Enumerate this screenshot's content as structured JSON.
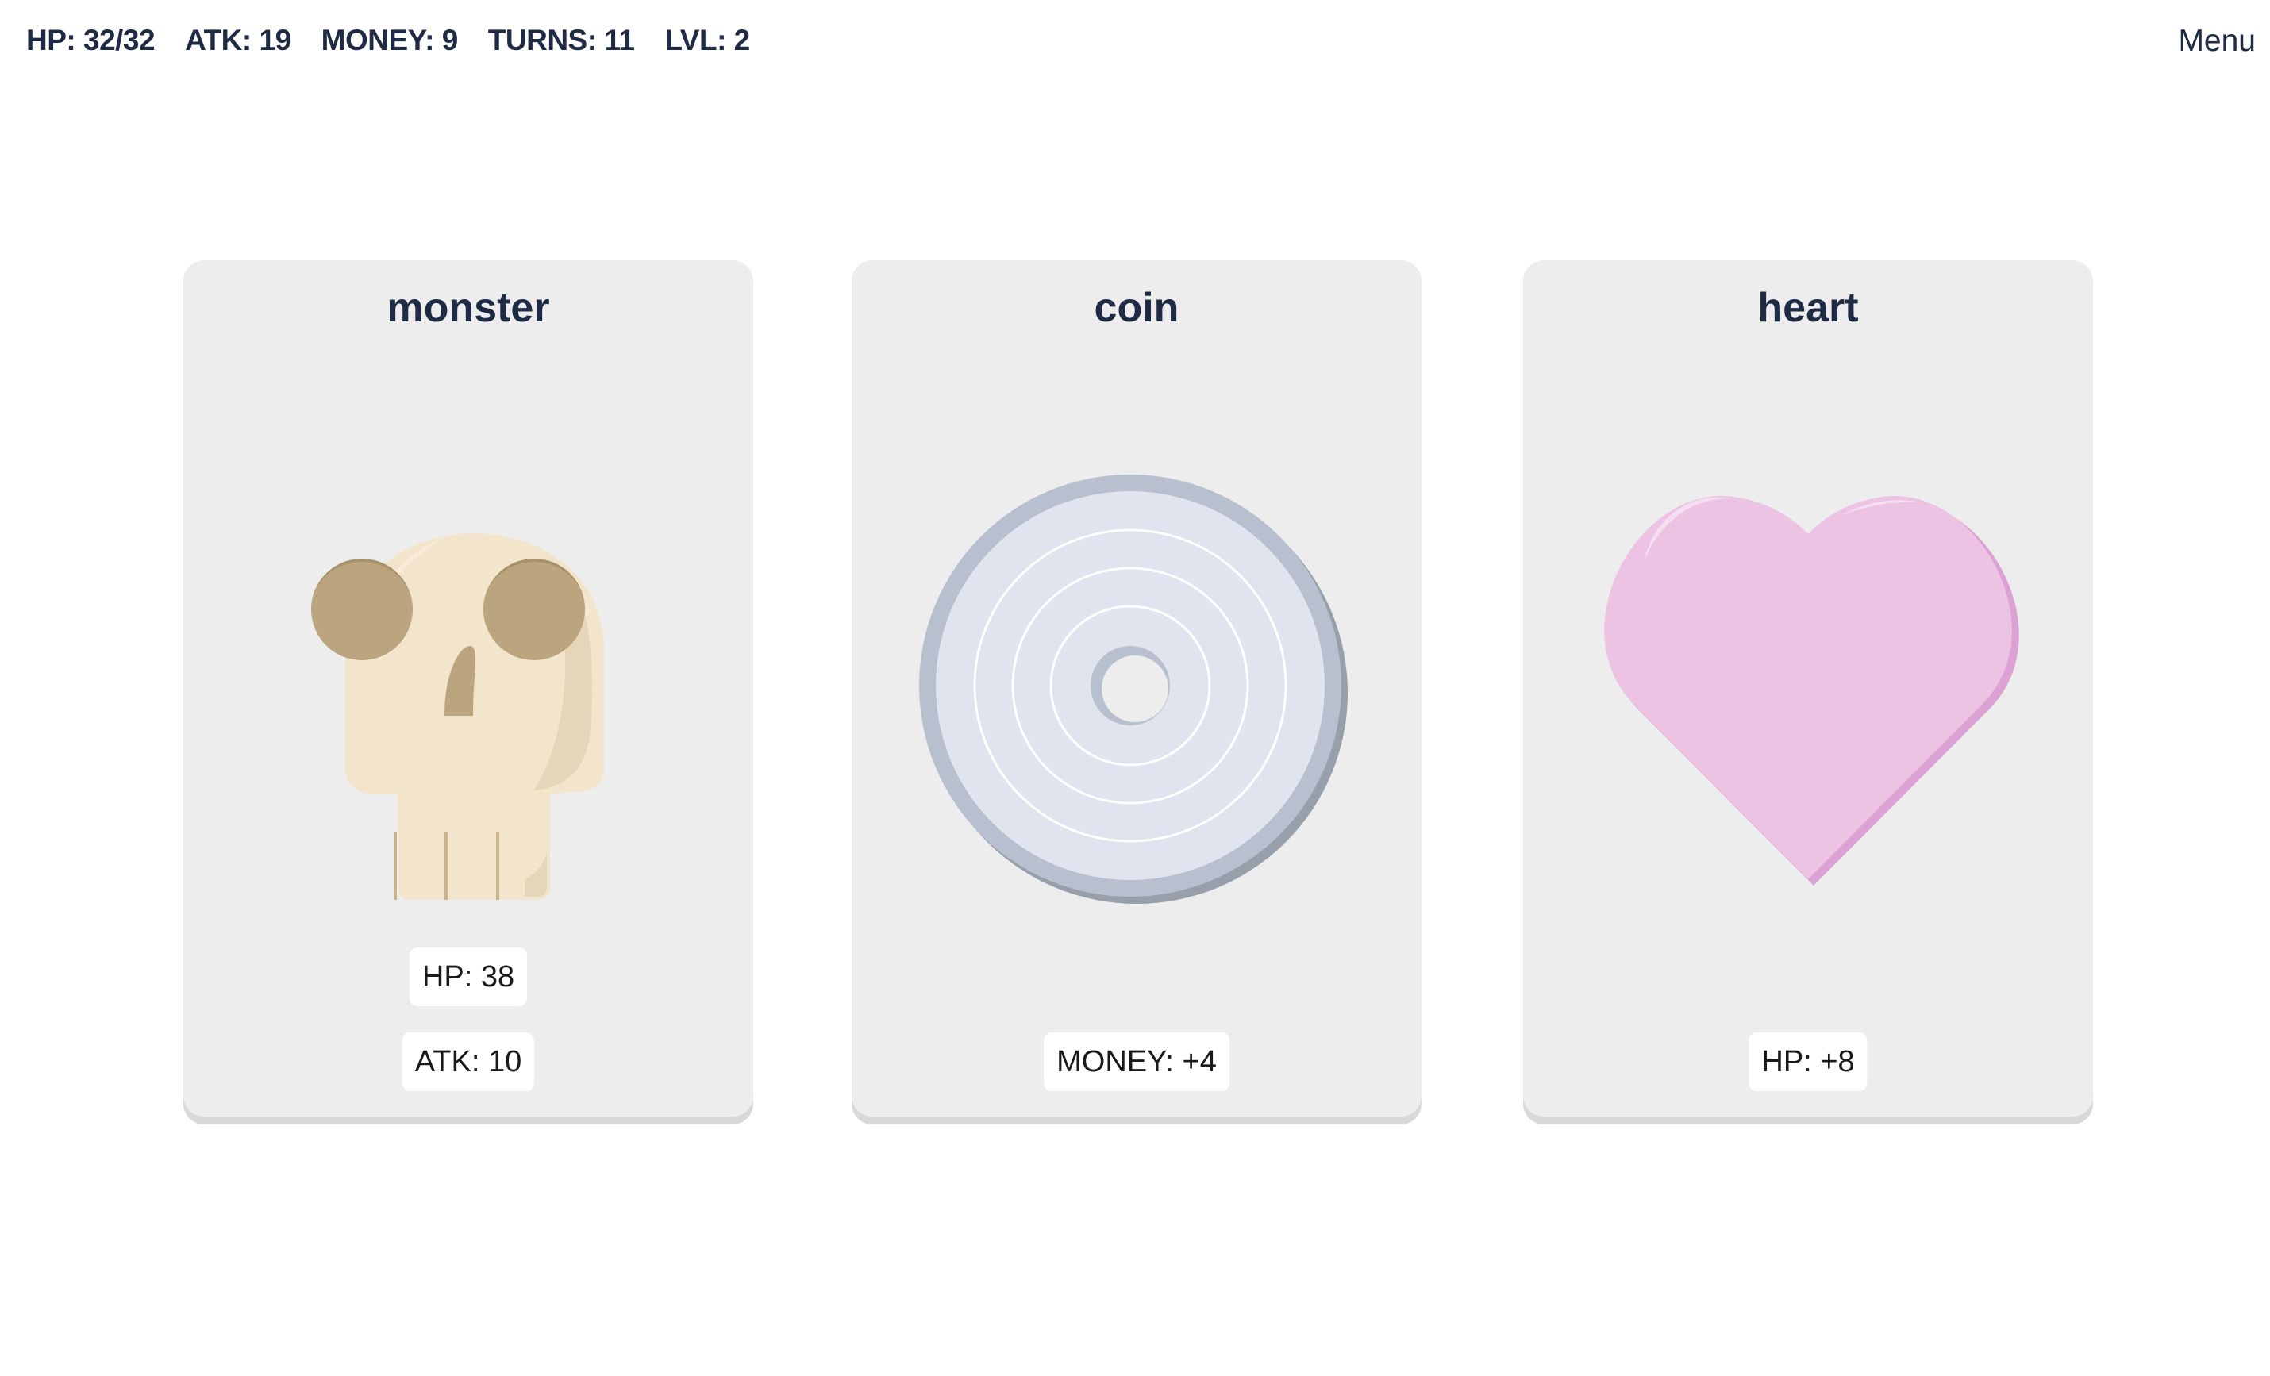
{
  "hud": {
    "hp": "HP: 32/32",
    "atk": "ATK: 19",
    "money": "MONEY: 9",
    "turns": "TURNS: 11",
    "lvl": "LVL: 2",
    "menu_label": "Menu"
  },
  "cards": [
    {
      "title": "monster",
      "icon": "skull-icon",
      "stats": [
        "HP: 38",
        "ATK: 10"
      ]
    },
    {
      "title": "coin",
      "icon": "coin-icon",
      "stats": [
        "MONEY: +4"
      ]
    },
    {
      "title": "heart",
      "icon": "heart-icon",
      "stats": [
        "HP: +8"
      ]
    }
  ],
  "colors": {
    "text": "#1f2a44",
    "card_bg": "#ededed",
    "skull": "#f3e5cc",
    "skull_shadow": "#baa57f",
    "coin": "#e0e4ee",
    "coin_rim": "#b8c0cf",
    "heart": "#ecc3e3"
  }
}
